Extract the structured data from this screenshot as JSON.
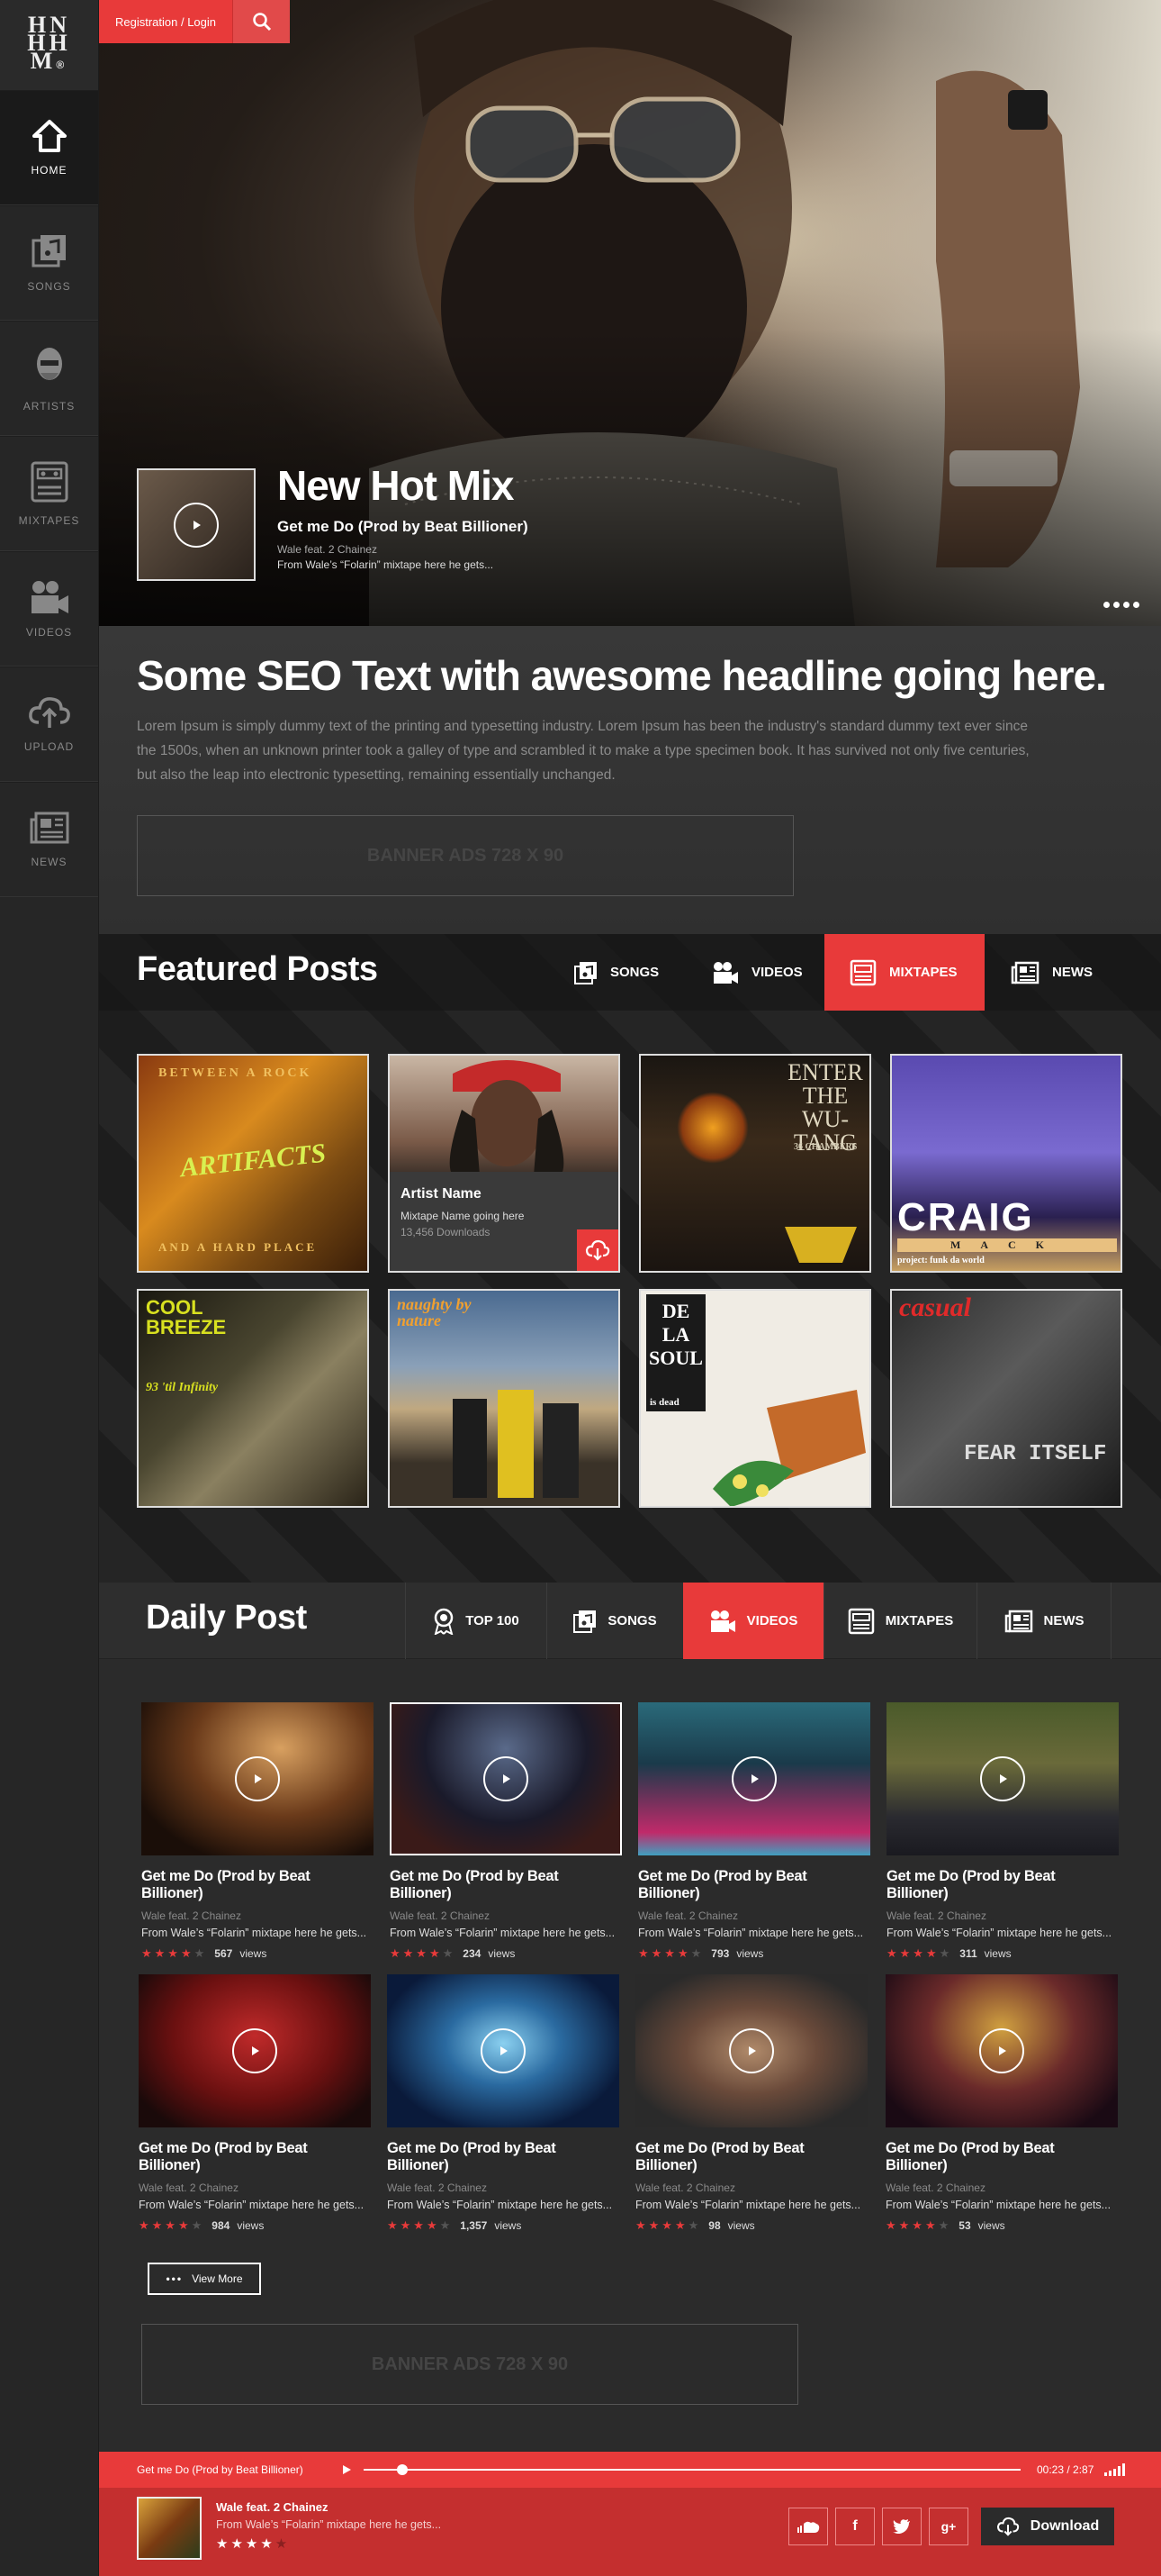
{
  "logo": {
    "line1": "HN",
    "line2": "HH",
    "line3": "M",
    "mark": "®"
  },
  "sidebar": {
    "items": [
      {
        "label": "HOME",
        "icon": "home-icon"
      },
      {
        "label": "SONGS",
        "icon": "music-note-icon"
      },
      {
        "label": "ARTISTS",
        "icon": "artist-icon"
      },
      {
        "label": "MIXTAPES",
        "icon": "cassette-icon"
      },
      {
        "label": "VIDEOS",
        "icon": "video-camera-icon"
      },
      {
        "label": "UPLOAD",
        "icon": "upload-cloud-icon"
      },
      {
        "label": "NEWS",
        "icon": "newspaper-icon"
      }
    ]
  },
  "header": {
    "registration_label": "Registration / Login"
  },
  "hero": {
    "title": "New Hot Mix",
    "subtitle": "Get me Do (Prod by Beat Billioner)",
    "artist": "Wale feat. 2 Chainez",
    "description": "From Wale’s “Folarin” mixtape here he gets..."
  },
  "seo": {
    "title": "Some SEO Text with awesome headline going here.",
    "text": "Lorem Ipsum is simply dummy text of the printing and typesetting industry. Lorem Ipsum has been the industry's standard dummy text ever since the 1500s, when an unknown printer took a galley of type and scrambled it to make a type specimen book. It has survived not only five centuries, but also the leap into electronic typesetting, remaining essentially unchanged.",
    "banner": "BANNER ADS 728 X 90"
  },
  "featured": {
    "title": "Featured Posts",
    "tabs": [
      "SONGS",
      "VIDEOS",
      "MIXTAPES",
      "NEWS"
    ],
    "artist_card": {
      "name": "Artist Name",
      "mixtape": "Mixtape Name going here",
      "downloads": "13,456 Downloads"
    },
    "covers": [
      {
        "label": "ARTIFACTS",
        "top": "BETWEEN A ROCK",
        "bottom": "AND A HARD PLACE"
      },
      {
        "label": ""
      },
      {
        "label": "ENTER THE WU-TANG",
        "bottom": "36 CHAMBERS"
      },
      {
        "label": "CRAIG",
        "bottom": "MACK",
        "extra": "project: funk da world"
      },
      {
        "label": "COOL BREEZE",
        "bottom": "93 'til Infinity"
      },
      {
        "label": "naughty by nature"
      },
      {
        "label": "DE LA SOUL",
        "bottom": "is dead"
      },
      {
        "label": "casual",
        "bottom": "FEAR ITSELF"
      }
    ]
  },
  "daily": {
    "title": "Daily Post",
    "tabs": [
      "TOP 100",
      "SONGS",
      "VIDEOS",
      "MIXTAPES",
      "NEWS"
    ],
    "cards": [
      {
        "title": "Get me Do (Prod by Beat Billioner)",
        "artist": "Wale feat. 2 Chainez",
        "desc": "From Wale’s “Folarin” mixtape here he gets...",
        "views": "567",
        "rating": 4
      },
      {
        "title": "Get me Do (Prod by Beat Billioner)",
        "artist": "Wale feat. 2 Chainez",
        "desc": "From Wale’s “Folarin” mixtape here he gets...",
        "views": "234",
        "rating": 4
      },
      {
        "title": "Get me Do (Prod by Beat Billioner)",
        "artist": "Wale feat. 2 Chainez",
        "desc": "From Wale’s “Folarin” mixtape here he gets...",
        "views": "793",
        "rating": 4
      },
      {
        "title": "Get me Do (Prod by Beat Billioner)",
        "artist": "Wale feat. 2 Chainez",
        "desc": "From Wale’s “Folarin” mixtape here he gets...",
        "views": "311",
        "rating": 4
      },
      {
        "title": "Get me Do (Prod by Beat Billioner)",
        "artist": "Wale feat. 2 Chainez",
        "desc": "From Wale’s “Folarin” mixtape here he gets...",
        "views": "984",
        "rating": 4
      },
      {
        "title": "Get me Do (Prod by Beat Billioner)",
        "artist": "Wale feat. 2 Chainez",
        "desc": "From Wale’s “Folarin” mixtape here he gets...",
        "views": "1,357",
        "rating": 4
      },
      {
        "title": "Get me Do (Prod by Beat Billioner)",
        "artist": "Wale feat. 2 Chainez",
        "desc": "From Wale’s “Folarin” mixtape here he gets...",
        "views": "98",
        "rating": 4
      },
      {
        "title": "Get me Do (Prod by Beat Billioner)",
        "artist": "Wale feat. 2 Chainez",
        "desc": "From Wale’s “Folarin” mixtape here he gets...",
        "views": "53",
        "rating": 4
      }
    ],
    "views_suffix": "views",
    "view_more": "View More",
    "banner": "BANNER ADS 728 X 90"
  },
  "player": {
    "track": "Get me Do (Prod by Beat Billioner)",
    "time": "00:23 / 2:87",
    "progress": 0.05,
    "artist": "Wale feat. 2 Chainez",
    "desc": "From Wale’s “Folarin” mixtape here he gets...",
    "rating": 4,
    "download_label": "Download"
  },
  "colors": {
    "accent": "#e83a3a",
    "background": "#2b2b2b",
    "sidebar": "#262626"
  }
}
